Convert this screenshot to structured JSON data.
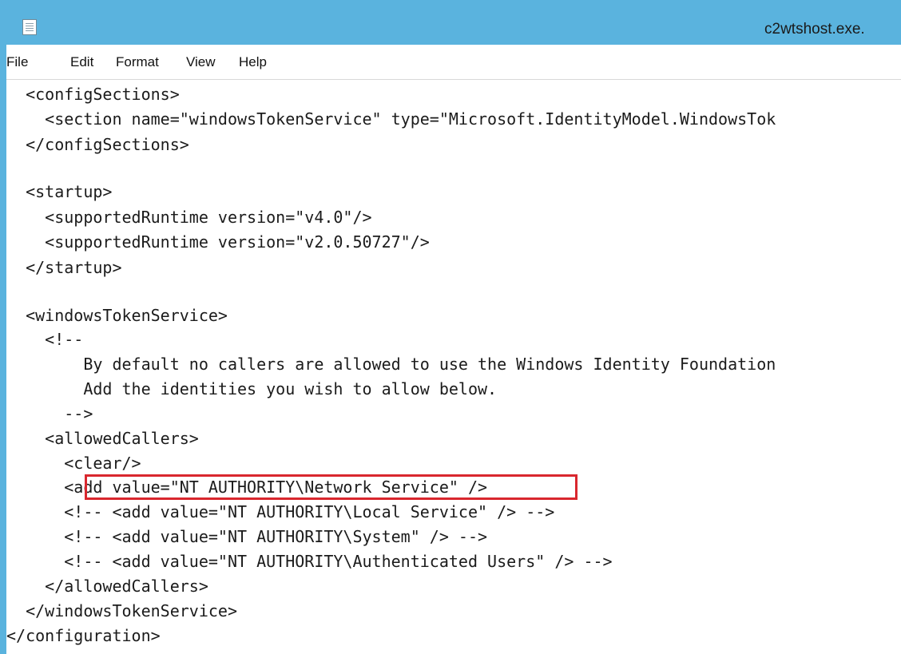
{
  "window": {
    "title": "c2wtshost.exe.",
    "frame_color": "#5ab3de",
    "icon": "notepad-icon"
  },
  "menubar": {
    "file": "File",
    "edit": "Edit",
    "format": "Format",
    "view": "View",
    "help": "Help"
  },
  "editor": {
    "highlight_color": "#d9272e",
    "lines": [
      "  <configSections>",
      "    <section name=\"windowsTokenService\" type=\"Microsoft.IdentityModel.WindowsTok",
      "  </configSections>",
      "",
      "  <startup>",
      "    <supportedRuntime version=\"v4.0\"/>",
      "    <supportedRuntime version=\"v2.0.50727\"/>",
      "  </startup>",
      "",
      "  <windowsTokenService>",
      "    <!--",
      "        By default no callers are allowed to use the Windows Identity Foundation",
      "        Add the identities you wish to allow below.",
      "      -->",
      "    <allowedCallers>",
      "      <clear/>",
      "      <add value=\"NT AUTHORITY\\Network Service\" />",
      "      <!-- <add value=\"NT AUTHORITY\\Local Service\" /> -->",
      "      <!-- <add value=\"NT AUTHORITY\\System\" /> -->",
      "      <!-- <add value=\"NT AUTHORITY\\Authenticated Users\" /> -->",
      "    </allowedCallers>",
      "  </windowsTokenService>",
      "</configuration>"
    ]
  }
}
